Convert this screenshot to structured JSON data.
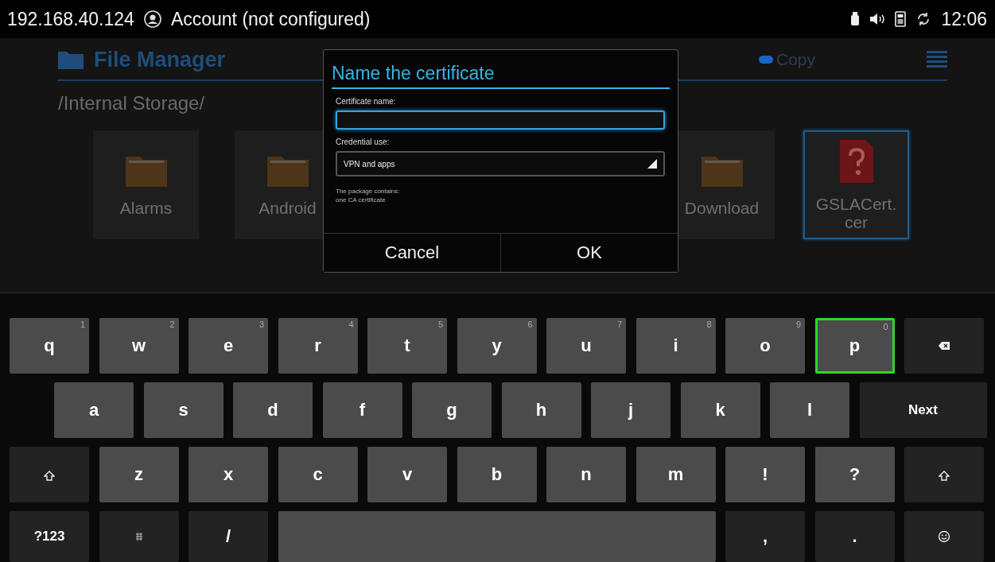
{
  "status_bar": {
    "ip": "192.168.40.124",
    "account": "Account (not configured)",
    "time": "12:06"
  },
  "file_manager": {
    "title": "File Manager",
    "actions": [
      {
        "label": "Copy",
        "color": "#1a63c4"
      }
    ],
    "path": "/Internal Storage/",
    "items_left": [
      {
        "name": "Alarms",
        "kind": "folder",
        "selected": false
      },
      {
        "name": "Android",
        "kind": "folder",
        "selected": false
      }
    ],
    "items_right": [
      {
        "name": "Download",
        "kind": "folder",
        "selected": false
      },
      {
        "name": "GSLACert.\ncer",
        "kind": "unknown-file",
        "selected": true
      }
    ]
  },
  "dialog": {
    "title": "Name the certificate",
    "name_label": "Certificate name:",
    "use_label": "Credential use:",
    "use_value": "VPN and apps",
    "note": "The package contains:\none CA certificate",
    "buttons": [
      "Cancel",
      "OK"
    ]
  },
  "keyboard": {
    "rows": [
      {
        "keys": [
          {
            "kind": "letter",
            "label": "q",
            "hint": "1",
            "selected": false
          },
          {
            "kind": "letter",
            "label": "w",
            "hint": "2",
            "selected": false
          },
          {
            "kind": "letter",
            "label": "e",
            "hint": "3",
            "selected": false
          },
          {
            "kind": "letter",
            "label": "r",
            "hint": "4",
            "selected": false
          },
          {
            "kind": "letter",
            "label": "t",
            "hint": "5",
            "selected": false
          },
          {
            "kind": "letter",
            "label": "y",
            "hint": "6",
            "selected": false
          },
          {
            "kind": "letter",
            "label": "u",
            "hint": "7",
            "selected": false
          },
          {
            "kind": "letter",
            "label": "i",
            "hint": "8",
            "selected": false
          },
          {
            "kind": "letter",
            "label": "o",
            "hint": "9",
            "selected": false
          },
          {
            "kind": "letter",
            "label": "p",
            "hint": "0",
            "selected": true
          },
          {
            "kind": "backspace",
            "selected": false
          }
        ]
      },
      {
        "keys": [
          {
            "kind": "letter",
            "label": "a",
            "selected": false
          },
          {
            "kind": "letter",
            "label": "s",
            "selected": false
          },
          {
            "kind": "letter",
            "label": "d",
            "selected": false
          },
          {
            "kind": "letter",
            "label": "f",
            "selected": false
          },
          {
            "kind": "letter",
            "label": "g",
            "selected": false
          },
          {
            "kind": "letter",
            "label": "h",
            "selected": false
          },
          {
            "kind": "letter",
            "label": "j",
            "selected": false
          },
          {
            "kind": "letter",
            "label": "k",
            "selected": false
          },
          {
            "kind": "letter",
            "label": "l",
            "selected": false
          },
          {
            "kind": "action",
            "label": "Next",
            "selected": false
          }
        ]
      },
      {
        "keys": [
          {
            "kind": "shift",
            "selected": false
          },
          {
            "kind": "letter",
            "label": "z",
            "selected": false
          },
          {
            "kind": "letter",
            "label": "x",
            "selected": false
          },
          {
            "kind": "letter",
            "label": "c",
            "selected": false
          },
          {
            "kind": "letter",
            "label": "v",
            "selected": false
          },
          {
            "kind": "letter",
            "label": "b",
            "selected": false
          },
          {
            "kind": "letter",
            "label": "n",
            "selected": false
          },
          {
            "kind": "letter",
            "label": "m",
            "selected": false
          },
          {
            "kind": "letter",
            "label": "!",
            "selected": false
          },
          {
            "kind": "letter",
            "label": "?",
            "selected": false
          },
          {
            "kind": "shift",
            "selected": false
          }
        ]
      },
      {
        "keys": [
          {
            "kind": "action",
            "label": "?123",
            "selected": false
          },
          {
            "kind": "settings",
            "selected": false
          },
          {
            "kind": "symbol",
            "label": "/",
            "selected": false
          },
          {
            "kind": "space",
            "selected": false
          },
          {
            "kind": "symbol",
            "label": ",",
            "selected": false
          },
          {
            "kind": "symbol",
            "label": ".",
            "selected": false
          },
          {
            "kind": "emoji",
            "selected": false
          }
        ]
      }
    ]
  }
}
